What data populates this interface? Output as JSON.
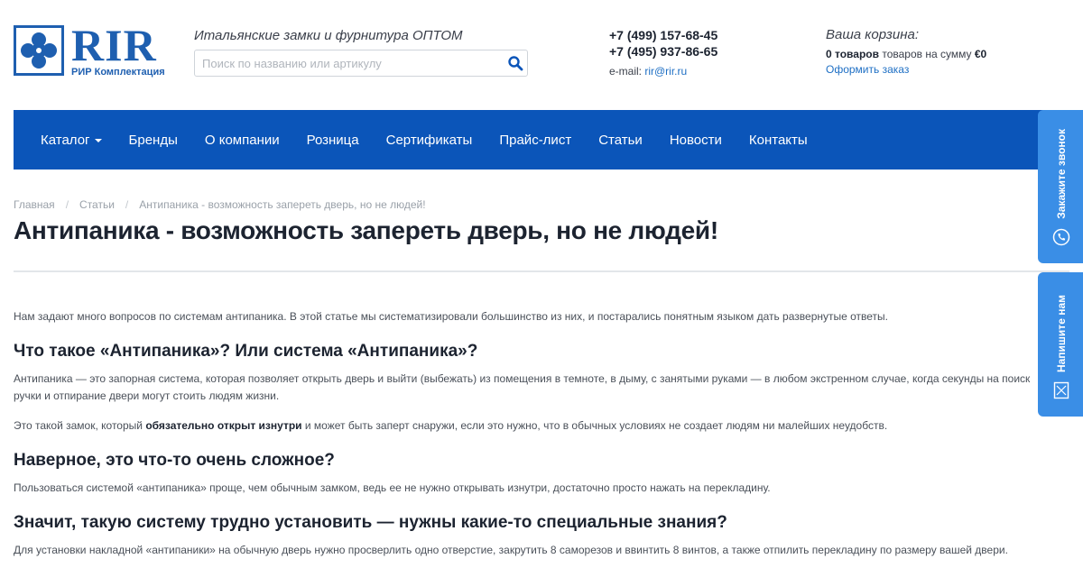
{
  "header": {
    "logo_big": "RIR",
    "logo_small": "РИР Комплектация",
    "tagline": "Итальянские замки и фурнитура ОПТОМ",
    "search_placeholder": "Поиск по названию или артикулу",
    "phone_1": "+7 (499) 157-68-45",
    "phone_2": "+7 (495) 937-86-65",
    "email_label": "e-mail: ",
    "email": "rir@rir.ru",
    "cart_title": "Ваша корзина:",
    "cart_count": "0 товаров",
    "cart_mid": " товаров на сумму ",
    "cart_sum": "€0",
    "cart_order": "Оформить заказ"
  },
  "nav": {
    "items": [
      "Каталог",
      "Бренды",
      "О компании",
      "Розница",
      "Сертификаты",
      "Прайс-лист",
      "Статьи",
      "Новости",
      "Контакты"
    ]
  },
  "side": {
    "call": "Закажите звонок",
    "write": "Напишите нам"
  },
  "breadcrumb": {
    "home": "Главная",
    "section": "Статьи",
    "current": "Антипаника - возможность запереть дверь, но не людей!"
  },
  "article": {
    "title": "Антипаника - возможность запереть дверь, но не людей!",
    "intro": "Нам задают много вопросов по системам антипаника. В этой статье мы систематизировали большинство из них, и постарались понятным языком дать развернутые ответы.",
    "h1": "Что такое «Антипаника»? Или система «Антипаника»?",
    "p1": "Антипаника — это запорная система, которая позволяет открыть дверь и выйти (выбежать) из помещения в темноте, в дыму, с занятыми руками — в любом экстренном случае, когда секунды на поиск",
    "p1b": "ручки и отпирание двери могут стоить людям жизни.",
    "p2_a": "Это такой замок, который ",
    "p2_b": "обязательно открыт изнутри",
    "p2_c": " и может быть заперт снаружи, если это нужно, что в обычных условиях не создает людям ни малейших неудобств.",
    "h2": "Наверное, это что-то очень сложное?",
    "p3": "Пользоваться системой «антипаника» проще, чем обычным замком, ведь ее не нужно открывать изнутри, достаточно просто нажать на перекладину.",
    "h3": "Значит, такую систему трудно установить — нужны какие-то специальные знания?",
    "p4": "Для установки накладной «антипаники» на обычную дверь нужно просверлить одно отверстие, закрутить 8 саморезов и ввинтить 8 винтов, а также отпилить перекладину по размеру вашей двери."
  },
  "colors": {
    "brand": "#1e5fb0",
    "nav_bg": "#0b55b9",
    "side_tab": "#3a8ee6",
    "link": "#1e6fc4"
  }
}
